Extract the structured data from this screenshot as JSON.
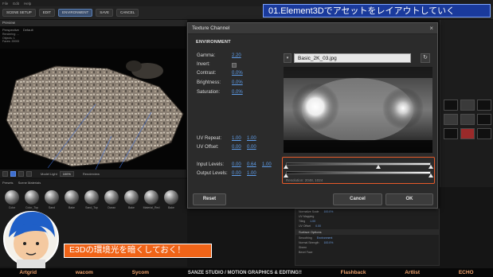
{
  "host": {
    "menu": [
      "File",
      "Edit",
      "Help"
    ],
    "toolbar": [
      "SCENE SETUP",
      "EDIT",
      "ENVIRONMENT",
      "SAVE",
      "CANCEL"
    ],
    "preview": {
      "title": "Preview",
      "options": [
        "Perspective",
        "Default"
      ],
      "stats": [
        "Rendering: ...",
        "Objects: 1",
        "Faces: 20000"
      ]
    },
    "viewport_toolbar": {
      "label": "Model Light",
      "zoom": "100%",
      "render": "Renderview"
    },
    "preset_tabs": [
      "Presets",
      "Scene Materials"
    ],
    "materials": [
      "Color",
      "Color_Top",
      "Sand",
      "Bake",
      "Sand_Top",
      "Ocean",
      "Bake",
      "Material_Red",
      "Bake"
    ],
    "lower_panel": {
      "rows": [
        [
          "Normalize Scale",
          "100.0%"
        ],
        [
          "UV Mapping",
          ""
        ],
        [
          "Tiling",
          "1.00"
        ],
        [
          "UV Offset",
          "0.00"
        ]
      ],
      "section": "Surface Options",
      "rows2": [
        [
          "Smoothing",
          "Environment"
        ],
        [
          "Normal Strength",
          "100.0%"
        ],
        [
          "Sheen",
          ""
        ],
        [
          "Bevel Face",
          ""
        ]
      ]
    }
  },
  "dialog": {
    "title": "Texture Channel",
    "close": "×",
    "section": "ENVIRONMENT",
    "gamma": {
      "label": "Gamma:",
      "value": "2.20"
    },
    "invert": {
      "label": "Invert:"
    },
    "contrast": {
      "label": "Contrast:",
      "value": "0.0%"
    },
    "brightness": {
      "label": "Brightness:",
      "value": "0.0%"
    },
    "saturation": {
      "label": "Saturation:",
      "value": "0.0%"
    },
    "uv_repeat": {
      "label": "UV Repeat:",
      "x": "1.00",
      "y": "1.00"
    },
    "uv_offset": {
      "label": "UV Offset:",
      "x": "0.00",
      "y": "0.00"
    },
    "input_levels": {
      "label": "Input Levels:",
      "values": [
        "0.00",
        "0.64",
        "1.00"
      ],
      "handles": [
        0.0,
        0.64,
        1.0
      ]
    },
    "output_levels": {
      "label": "Output Levels:",
      "values": [
        "0.00",
        "1.00"
      ],
      "handles": [
        0.0,
        1.0
      ]
    },
    "texture_name": "Basic_2K_03.jpg",
    "resolution": "Resolution: 2048, 1024",
    "buttons": {
      "reset": "Reset",
      "cancel": "Cancel",
      "ok": "OK"
    }
  },
  "overlay": {
    "banner": "01.Element3Dでアセットをレイアウトしていく",
    "caption": "E3Dの環境光を暗くしておく！",
    "sponsors": [
      "Artgrid",
      "wacom",
      "Sycom",
      "SANZE STUDIO / MOTION GRAPHICS & EDITING!!",
      "Flashback",
      "Artlist",
      "ECHO"
    ]
  },
  "colors": {
    "accent_blue": "#5e9ce8",
    "highlight_orange": "#e65a2a",
    "banner_blue": "#1a3a9c",
    "caption_orange": "#f06418"
  }
}
